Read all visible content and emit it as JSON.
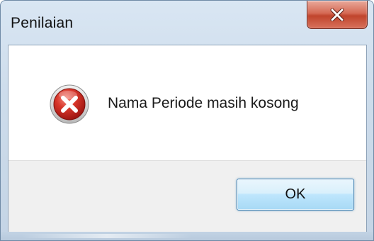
{
  "window": {
    "title": "Penilaian",
    "close_icon": "close-icon"
  },
  "dialog": {
    "icon": "error-icon",
    "message": "Nama Periode masih kosong",
    "ok_label": "OK"
  },
  "colors": {
    "close_button": "#c7503a",
    "error_icon": "#c62828",
    "ok_border": "#3c7fb1",
    "button_area": "#f0f0f0"
  }
}
